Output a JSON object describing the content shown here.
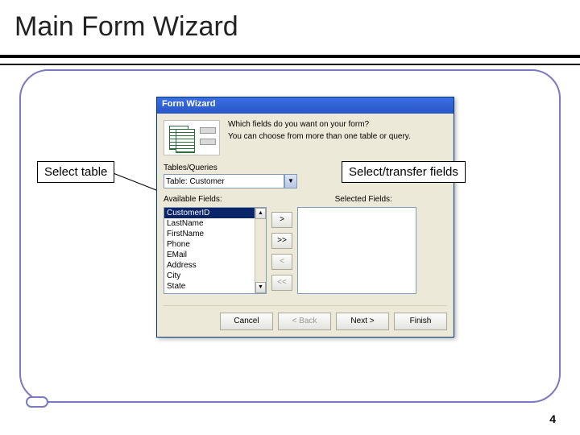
{
  "slide": {
    "title": "Main Form Wizard",
    "page_number": "4"
  },
  "callouts": {
    "left": "Select table",
    "right": "Select/transfer fields"
  },
  "dialog": {
    "title": "Form Wizard",
    "msg1": "Which fields do you want on your form?",
    "msg2": "You can choose from more than one table or query.",
    "tables_queries_label": "Tables/Queries",
    "combo_value": "Table: Customer",
    "available_label": "Available Fields:",
    "selected_label": "Selected Fields:",
    "available_fields": [
      "CustomerID",
      "LastName",
      "FirstName",
      "Phone",
      "EMail",
      "Address",
      "City",
      "State"
    ],
    "xfer": {
      "one": ">",
      "all": ">>",
      "back_one": "<",
      "back_all": "<<"
    },
    "buttons": {
      "cancel": "Cancel",
      "back": "< Back",
      "next": "Next >",
      "finish": "Finish"
    }
  }
}
